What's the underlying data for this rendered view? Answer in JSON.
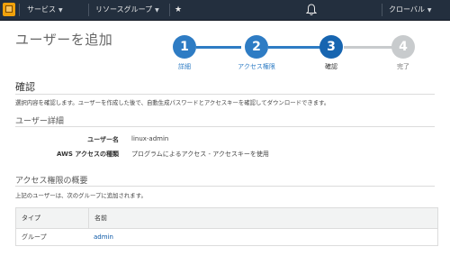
{
  "topbar": {
    "services_label": "サービス",
    "resource_groups_label": "リソースグループ",
    "user_label": "クローバル"
  },
  "page": {
    "title": "ユーザーを追加"
  },
  "steps": [
    {
      "number": "1",
      "label": "詳細",
      "state": "done"
    },
    {
      "number": "2",
      "label": "アクセス権限",
      "state": "done"
    },
    {
      "number": "3",
      "label": "確認",
      "state": "current"
    },
    {
      "number": "4",
      "label": "完了",
      "state": "todo"
    }
  ],
  "colors": {
    "done": "#2e7cc4",
    "current": "#1765b0",
    "todo": "#c8cbcd",
    "topbar": "#232f3e"
  },
  "review": {
    "title": "確認",
    "description": "選択内容を確認します。ユーザーを作成した後で、自動生成パスワードとアクセスキーを確認してダウンロードできます。"
  },
  "user_details": {
    "title": "ユーザー詳細",
    "rows": [
      {
        "key": "ユーザー名",
        "value": "linux-admin"
      },
      {
        "key": "AWS アクセスの種類",
        "value": "プログラムによるアクセス - アクセスキーを使用"
      }
    ]
  },
  "permissions": {
    "title": "アクセス権限の概要",
    "description": "上記のユーザーは、次のグループに追加されます。",
    "columns": [
      "タイプ",
      "名前"
    ],
    "rows": [
      {
        "type": "グループ",
        "name": "admin"
      }
    ]
  }
}
